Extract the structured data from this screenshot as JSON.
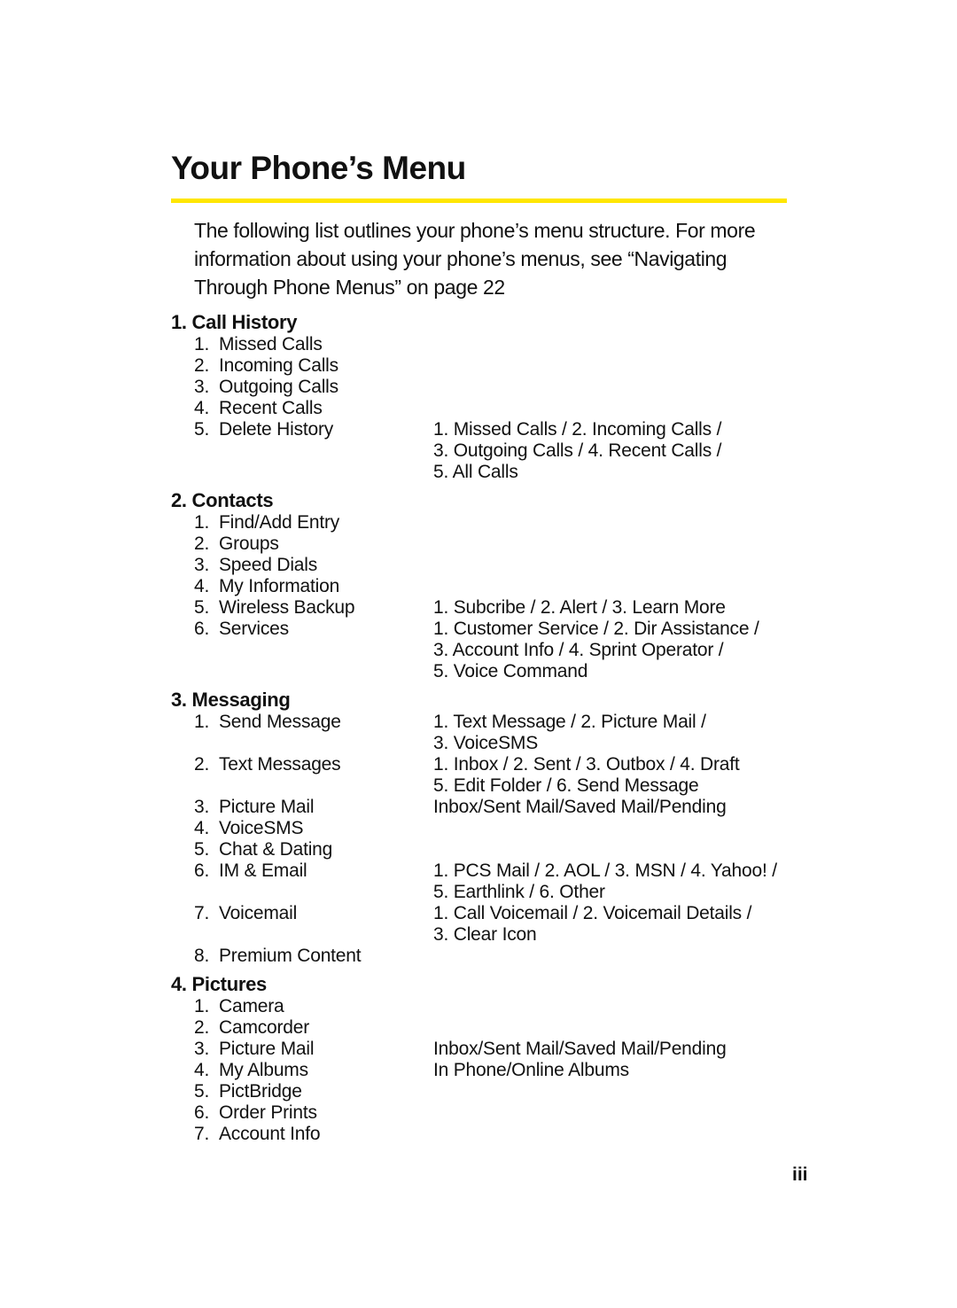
{
  "page": {
    "title": "Your Phone’s Menu",
    "accent_color": "#ffe600",
    "intro": "The following list outlines your phone’s menu structure. For more information about using your phone’s menus, see “Navigating Through Phone Menus” on page 22",
    "page_number": "iii"
  },
  "sections": [
    {
      "heading": "1. Call History",
      "items": [
        {
          "num": "1.",
          "label": "Missed Calls"
        },
        {
          "num": "2.",
          "label": "Incoming Calls"
        },
        {
          "num": "3.",
          "label": "Outgoing Calls"
        },
        {
          "num": "4.",
          "label": "Recent Calls"
        },
        {
          "num": "5.",
          "label": "Delete History",
          "sub": [
            "1. Missed Calls / 2. Incoming Calls /",
            "3. Outgoing Calls / 4. Recent Calls /",
            "5. All Calls"
          ]
        }
      ]
    },
    {
      "heading": "2. Contacts",
      "items": [
        {
          "num": "1.",
          "label": "Find/Add  Entry"
        },
        {
          "num": "2.",
          "label": "Groups"
        },
        {
          "num": "3.",
          "label": "Speed Dials"
        },
        {
          "num": "4.",
          "label": "My Information"
        },
        {
          "num": "5.",
          "label": "Wireless Backup",
          "sub": [
            "1. Subcribe / 2. Alert / 3. Learn More"
          ]
        },
        {
          "num": "6.",
          "label": "Services",
          "sub": [
            "1. Customer Service / 2. Dir Assistance /",
            "3. Account Info / 4. Sprint Operator /",
            "5. Voice Command"
          ]
        }
      ]
    },
    {
      "heading": "3. Messaging",
      "items": [
        {
          "num": "1.",
          "label": "Send Message",
          "sub": [
            "1. Text Message / 2. Picture Mail /",
            "3. VoiceSMS"
          ]
        },
        {
          "num": "2.",
          "label": "Text Messages",
          "sub": [
            "1. Inbox / 2. Sent / 3. Outbox / 4. Draft",
            "5. Edit Folder / 6. Send Message"
          ]
        },
        {
          "num": "3.",
          "label": "Picture Mail",
          "sub": [
            "Inbox/Sent Mail/Saved Mail/Pending"
          ]
        },
        {
          "num": "4.",
          "label": "VoiceSMS"
        },
        {
          "num": "5.",
          "label": "Chat & Dating"
        },
        {
          "num": "6.",
          "label": "IM & Email",
          "sub": [
            "1. PCS Mail / 2. AOL / 3. MSN / 4. Yahoo! /",
            "5. Earthlink / 6. Other"
          ]
        },
        {
          "num": "7.",
          "label": "Voicemail",
          "sub": [
            "1. Call Voicemail / 2. Voicemail Details /",
            "3. Clear Icon"
          ]
        },
        {
          "num": "8.",
          "label": "Premium Content"
        }
      ]
    },
    {
      "heading": "4. Pictures",
      "items": [
        {
          "num": "1.",
          "label": "Camera"
        },
        {
          "num": "2.",
          "label": "Camcorder"
        },
        {
          "num": "3.",
          "label": "Picture Mail",
          "sub": [
            "Inbox/Sent Mail/Saved Mail/Pending"
          ]
        },
        {
          "num": "4.",
          "label": "My Albums",
          "sub": [
            "In Phone/Online Albums"
          ]
        },
        {
          "num": "5.",
          "label": "PictBridge"
        },
        {
          "num": "6.",
          "label": "Order Prints"
        },
        {
          "num": "7.",
          "label": "Account Info"
        }
      ]
    }
  ]
}
